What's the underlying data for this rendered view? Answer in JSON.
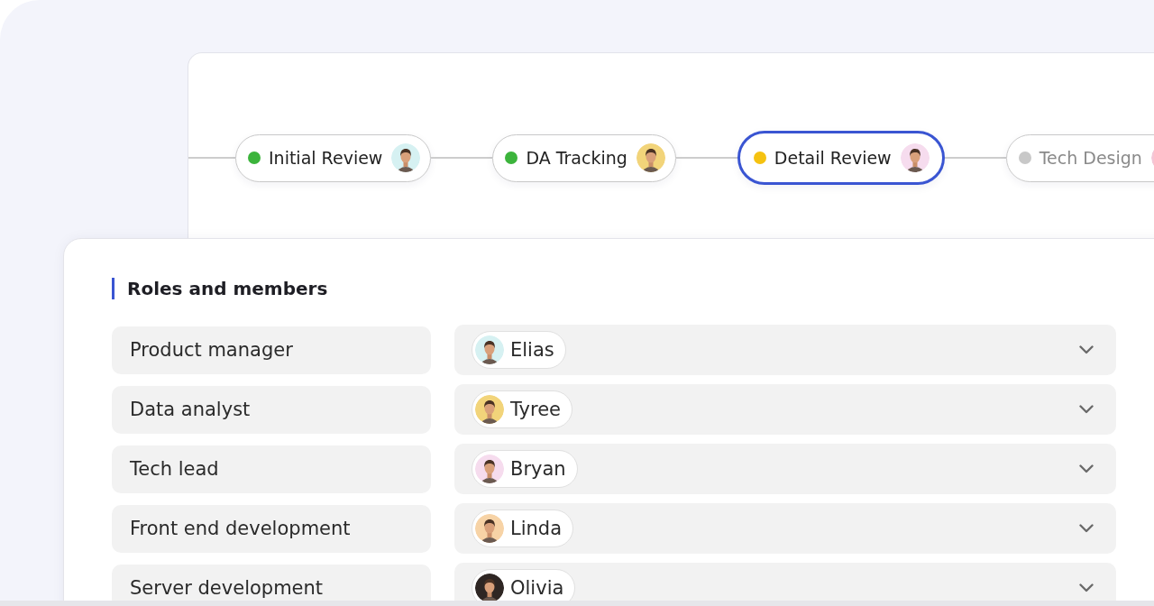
{
  "flow": {
    "nodes": [
      {
        "label": "Initial Review",
        "color": "#3cb43c",
        "disabled": false,
        "selected": false,
        "avatar": {
          "color": "#d6f1f2"
        }
      },
      {
        "label": "DA Tracking",
        "color": "#3cb43c",
        "disabled": false,
        "selected": false,
        "avatar": {
          "color": "#f2d47a"
        }
      },
      {
        "label": "Detail Review",
        "color": "#f5c211",
        "disabled": false,
        "selected": true,
        "avatar": {
          "color": "#f6dcee"
        }
      },
      {
        "label": "Tech Design",
        "color": "#c8c8c8",
        "disabled": true,
        "selected": false,
        "avatar": {
          "color": "#f3c6d6"
        }
      }
    ]
  },
  "roles_panel": {
    "title": "Roles and members",
    "rows": [
      {
        "role": "Product manager",
        "member": {
          "name": "Elias",
          "avatar": {
            "color": "#d6f1f2"
          }
        }
      },
      {
        "role": "Data analyst",
        "member": {
          "name": "Tyree",
          "avatar": {
            "color": "#f2d47a"
          }
        }
      },
      {
        "role": "Tech lead",
        "member": {
          "name": "Bryan",
          "avatar": {
            "color": "#f6dcee"
          }
        }
      },
      {
        "role": "Front end development",
        "member": {
          "name": "Linda",
          "avatar": {
            "color": "#f7d3a6"
          }
        }
      },
      {
        "role": "Server development",
        "member": {
          "name": "Olivia",
          "avatar": {
            "color": "#2e2623"
          }
        }
      }
    ]
  }
}
